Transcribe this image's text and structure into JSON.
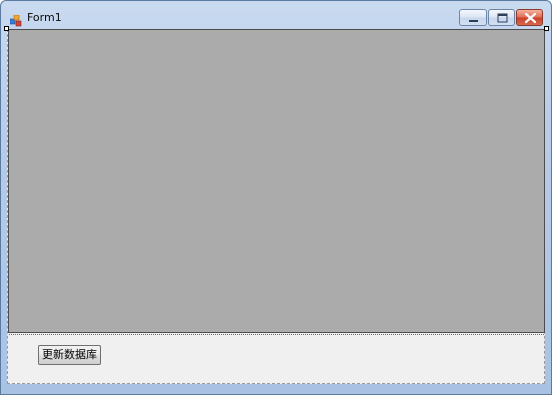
{
  "window": {
    "title": "Form1"
  },
  "titlebar_buttons": {
    "minimize": "minimize-icon",
    "maximize": "maximize-icon",
    "close": "close-icon"
  },
  "form": {
    "update_button_label": "更新数据库"
  },
  "colors": {
    "title_bar": "#b7cde9",
    "client_background": "#f0f0f0",
    "grid_background": "#ababab",
    "close_button": "#c9422b"
  }
}
